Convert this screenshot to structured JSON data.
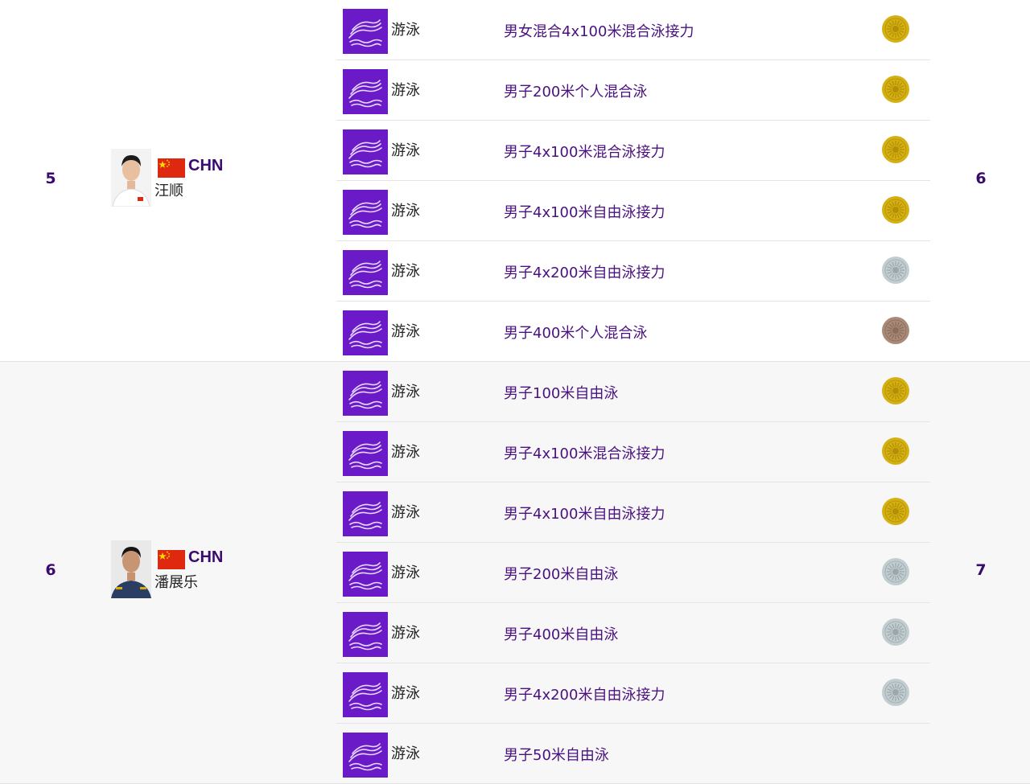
{
  "rows": [
    {
      "rank": "5",
      "country": "CHN",
      "name": "汪顺",
      "total": "6",
      "events": [
        {
          "sport": "游泳",
          "event": "男女混合4x100米混合泳接力",
          "medal": "gold"
        },
        {
          "sport": "游泳",
          "event": "男子200米个人混合泳",
          "medal": "gold"
        },
        {
          "sport": "游泳",
          "event": "男子4x100米混合泳接力",
          "medal": "gold"
        },
        {
          "sport": "游泳",
          "event": "男子4x100米自由泳接力",
          "medal": "gold"
        },
        {
          "sport": "游泳",
          "event": "男子4x200米自由泳接力",
          "medal": "silver"
        },
        {
          "sport": "游泳",
          "event": "男子400米个人混合泳",
          "medal": "bronze"
        }
      ]
    },
    {
      "rank": "6",
      "country": "CHN",
      "name": "潘展乐",
      "total": "7",
      "events": [
        {
          "sport": "游泳",
          "event": "男子100米自由泳",
          "medal": "gold"
        },
        {
          "sport": "游泳",
          "event": "男子4x100米混合泳接力",
          "medal": "gold"
        },
        {
          "sport": "游泳",
          "event": "男子4x100米自由泳接力",
          "medal": "gold"
        },
        {
          "sport": "游泳",
          "event": "男子200米自由泳",
          "medal": "silver"
        },
        {
          "sport": "游泳",
          "event": "男子400米自由泳",
          "medal": "silver"
        },
        {
          "sport": "游泳",
          "event": "男子4x200米自由泳接力",
          "medal": "silver"
        },
        {
          "sport": "游泳",
          "event": "男子50米自由泳",
          "medal": "none"
        }
      ]
    }
  ],
  "colors": {
    "accent": "#3a0a6e",
    "sport_icon_bg": "#6a1bc7",
    "gold": "#d4b012",
    "silver": "#c2cdd0",
    "bronze": "#a98a78"
  },
  "icons": {
    "sport": "swimming-pictogram-icon",
    "flag": "china-flag-icon"
  }
}
